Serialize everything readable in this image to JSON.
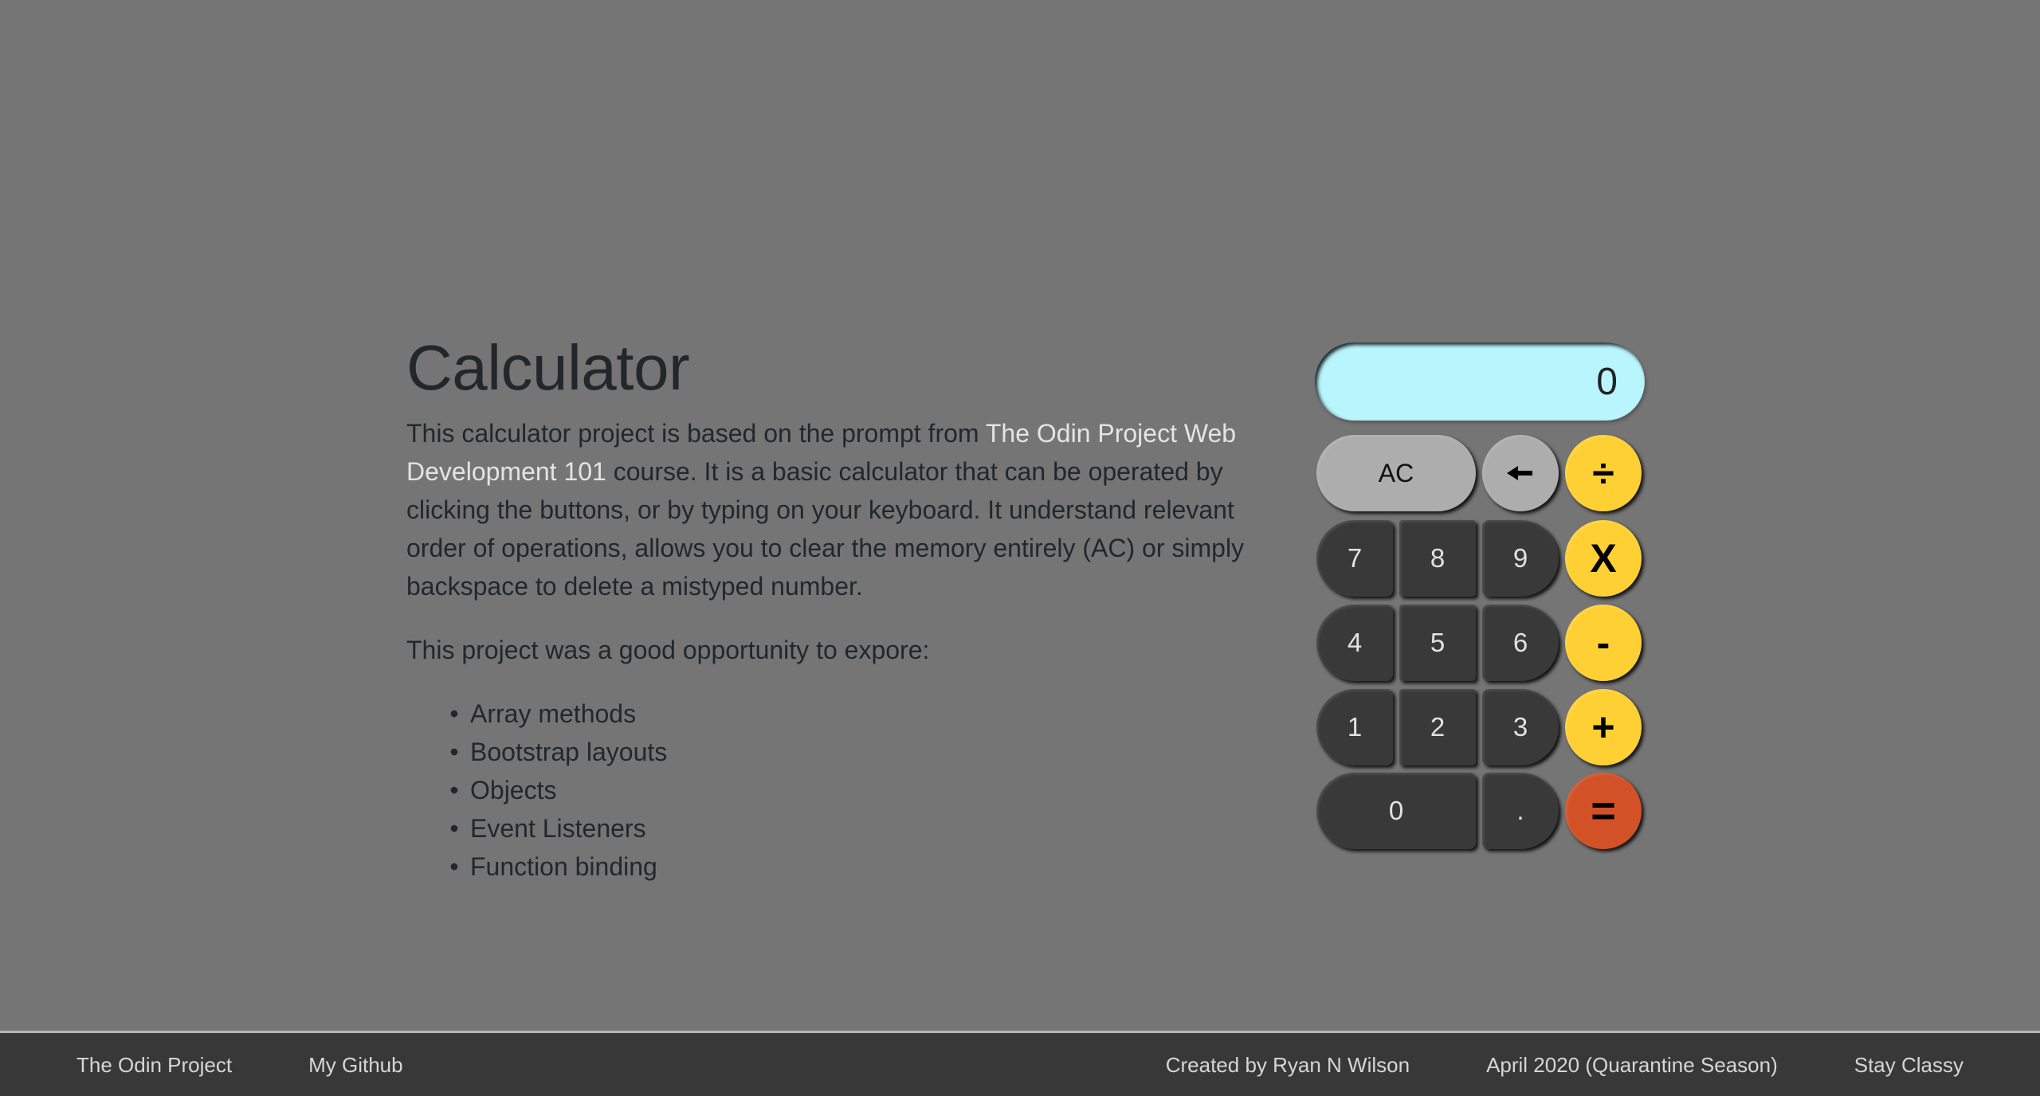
{
  "intro": {
    "title": "Calculator",
    "paragraph1": {
      "before_link": "This calculator project is based on the prompt from ",
      "link_text": "The Odin Project Web Development 101",
      "after_link": " course. It is a basic calculator that can be operated by clicking the buttons, or by typing on your keyboard. It understand relevant order of operations, allows you to clear the memory entirely (AC) or simply backspace to delete a mistyped number."
    },
    "paragraph2": "This project was a good opportunity to expore:",
    "topics": [
      "Array methods",
      "Bootstrap layouts",
      "Objects",
      "Event Listeners",
      "Function binding"
    ]
  },
  "calculator": {
    "display_value": "0",
    "keys": {
      "clear": "AC",
      "backspace": "←",
      "divide": "÷",
      "multiply": "X",
      "subtract": "-",
      "add": "+",
      "equals": "=",
      "decimal": ".",
      "d0": "0",
      "d1": "1",
      "d2": "2",
      "d3": "3",
      "d4": "4",
      "d5": "5",
      "d6": "6",
      "d7": "7",
      "d8": "8",
      "d9": "9"
    },
    "colors": {
      "display": "#b9f5fc",
      "digit": "#393939",
      "function": "#adadad",
      "operator": "#ffd034",
      "equals": "#d35127"
    }
  },
  "footer": {
    "left_links": [
      "The Odin Project",
      "My Github"
    ],
    "right_items": [
      "Created by Ryan N Wilson",
      "April 2020 (Quarantine Season)",
      "Stay Classy"
    ]
  }
}
